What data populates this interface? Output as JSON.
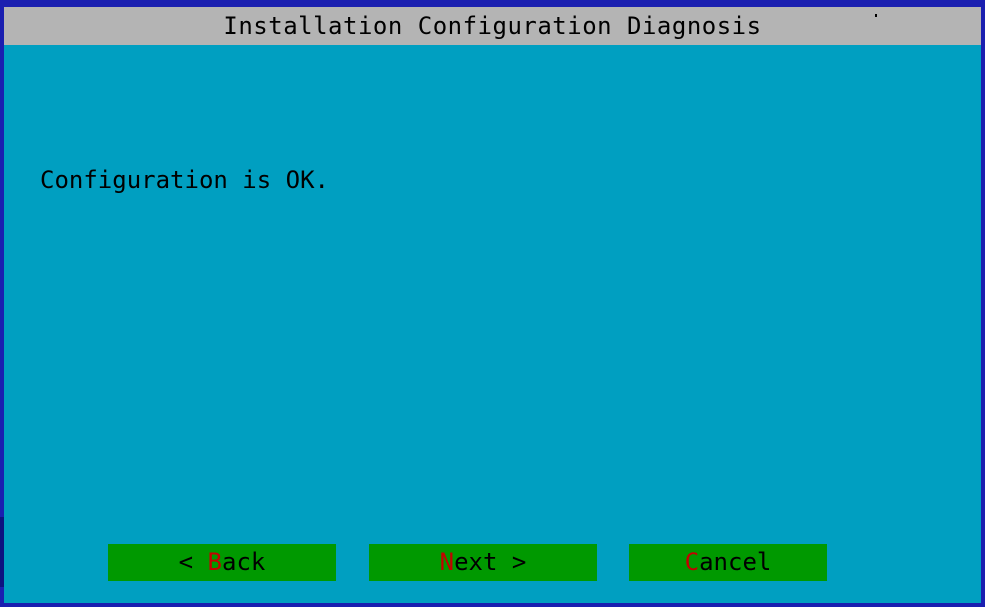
{
  "window": {
    "title": "Installation Configuration Diagnosis"
  },
  "main": {
    "message": "Configuration is OK."
  },
  "buttons": {
    "back": {
      "prefix": "< ",
      "hotkey": "B",
      "rest": "ack"
    },
    "next": {
      "prefix": "",
      "hotkey": "N",
      "rest": "ext >"
    },
    "cancel": {
      "prefix": "",
      "hotkey": "C",
      "rest": "ancel"
    }
  },
  "colors": {
    "background": "#009fc1",
    "title_bar": "#b4b4b4",
    "border": "#1a1fb0",
    "button": "#009900",
    "hotkey": "#c40000",
    "text": "#000000"
  }
}
